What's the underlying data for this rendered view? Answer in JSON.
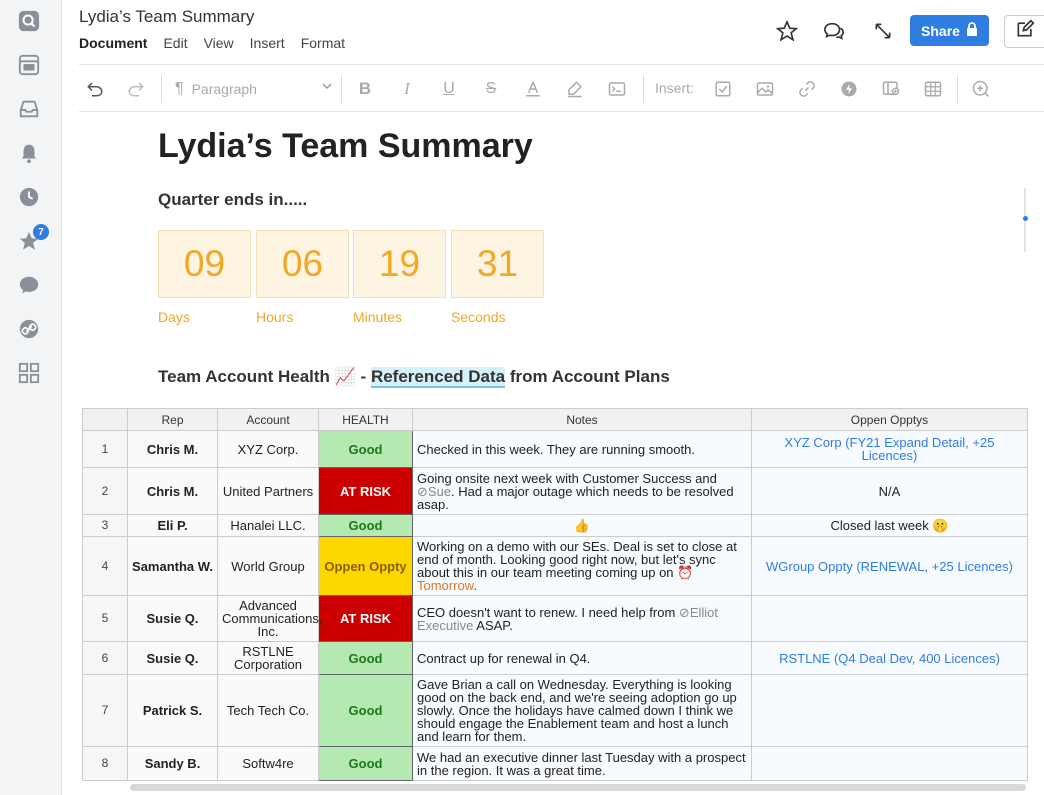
{
  "rail": {
    "badge_count": "7"
  },
  "header": {
    "title": "Lydia’s Team Summary",
    "menu": [
      "Document",
      "Edit",
      "View",
      "Insert",
      "Format"
    ],
    "share_label": "Share"
  },
  "toolbar": {
    "paragraph_label": "Paragraph",
    "insert_label": "Insert:"
  },
  "doc": {
    "title": "Lydia’s Team Summary",
    "subtitle": "Quarter ends in.....",
    "countdown": [
      {
        "value": "09",
        "label": "Days"
      },
      {
        "value": "06",
        "label": "Hours"
      },
      {
        "value": "19",
        "label": "Minutes"
      },
      {
        "value": "31",
        "label": "Seconds"
      }
    ],
    "section_prefix": "Team Account Health",
    "section_emoji": "📈",
    "section_dash": " - ",
    "section_ref": "Referenced Data",
    "section_suffix": " from Account Plans"
  },
  "table": {
    "headers": [
      "",
      "Rep",
      "Account",
      "HEALTH",
      "Notes",
      "Oppen Opptys"
    ],
    "rows": [
      {
        "num": "1",
        "rep": "Chris M.",
        "account": "XYZ Corp.",
        "health": "Good",
        "notes": "Checked in this week.  They are running smooth.",
        "opp": "XYZ Corp (FY21 Expand Detail, +25 Licences)"
      },
      {
        "num": "2",
        "rep": "Chris M.",
        "account": "United Partners",
        "health": "AT RISK",
        "notes_a": "Going onsite next week with Customer Success and ",
        "notes_mention": "Sue",
        "notes_b": ". Had a major outage which needs to be resolved asap.",
        "opp": "N/A"
      },
      {
        "num": "3",
        "rep": "Eli P.",
        "account": "Hanalei LLC.",
        "health": "Good",
        "notes": "👍",
        "opp": "Closed last week 🤫"
      },
      {
        "num": "4",
        "rep": "Samantha W.",
        "account": "World Group",
        "health": "Oppen Oppty",
        "notes_a": "Working on a demo with our SEs. Deal is set to close at end of month.  Looking good right now, but let's sync about this in our team meeting coming up on ",
        "notes_mention": "Tomorrow",
        "notes_b": ".",
        "opp": "WGroup Oppty (RENEWAL, +25 Licences)"
      },
      {
        "num": "5",
        "rep": "Susie Q.",
        "account": "Advanced Communications, Inc.",
        "health": "AT RISK",
        "notes_a": "CEO doesn't want to renew.  I need help from ",
        "notes_mention": "Elliot Executive",
        "notes_b": " ASAP.",
        "opp": ""
      },
      {
        "num": "6",
        "rep": "Susie Q.",
        "account": "RSTLNE Corporation",
        "health": "Good",
        "notes": "Contract up for renewal in Q4.",
        "opp": "RSTLNE (Q4 Deal Dev, 400 Licences)"
      },
      {
        "num": "7",
        "rep": "Patrick S.",
        "account": "Tech Tech Co.",
        "health": "Good",
        "notes": "Gave Brian a call on Wednesday.  Everything is looking good on the back end, and we're seeing adoption go up slowly.  Once the holidays have calmed down I think we should engage the Enablement team and host a lunch and learn for them.",
        "opp": ""
      },
      {
        "num": "8",
        "rep": "Sandy B.",
        "account": "Softw4re",
        "health": "Good",
        "notes": "We had an executive dinner last Tuesday with a prospect in the region. It was a great time.",
        "opp": ""
      }
    ]
  },
  "colors": {
    "accent": "#2f7de0",
    "countdown": "#f5a623",
    "good": "#b4eab2",
    "risk": "#cc0000",
    "oppty": "#ffd700"
  }
}
